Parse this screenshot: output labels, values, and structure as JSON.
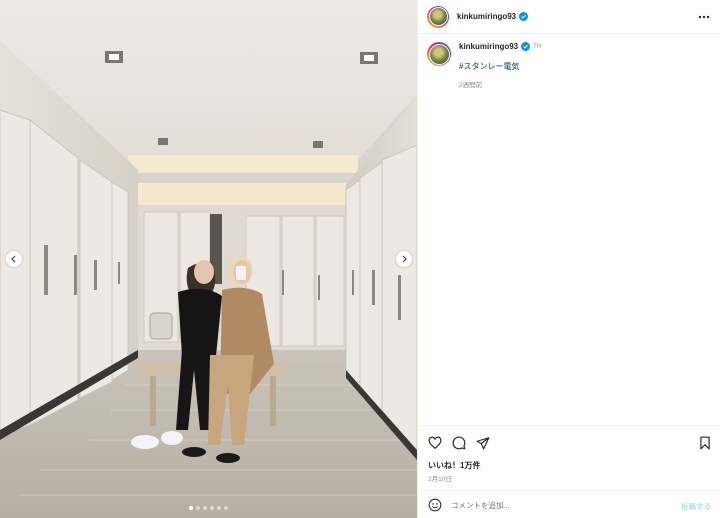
{
  "post": {
    "username": "kinkumiringo93",
    "verified": true,
    "tag": "TH",
    "caption_hashtag": "#スタンレー電気",
    "caption_time": "2週間前",
    "likes": "いいね！1万件",
    "date": "2月10日",
    "comment_placeholder": "コメントを追加...",
    "post_label": "投稿する"
  },
  "carousel": {
    "dots": 6,
    "active": 0
  },
  "icons": {
    "like": "heart-icon",
    "comment": "comment-icon",
    "share": "send-icon",
    "save": "bookmark-icon",
    "more": "more-icon",
    "emoji": "emoji-icon",
    "prev": "chevron-left-icon",
    "next": "chevron-right-icon",
    "verified": "verified-badge-icon"
  },
  "colors": {
    "verified": "#0095f6",
    "link": "#00376b",
    "muted": "#8e8e8e",
    "post_btn": "#b2dffc"
  }
}
